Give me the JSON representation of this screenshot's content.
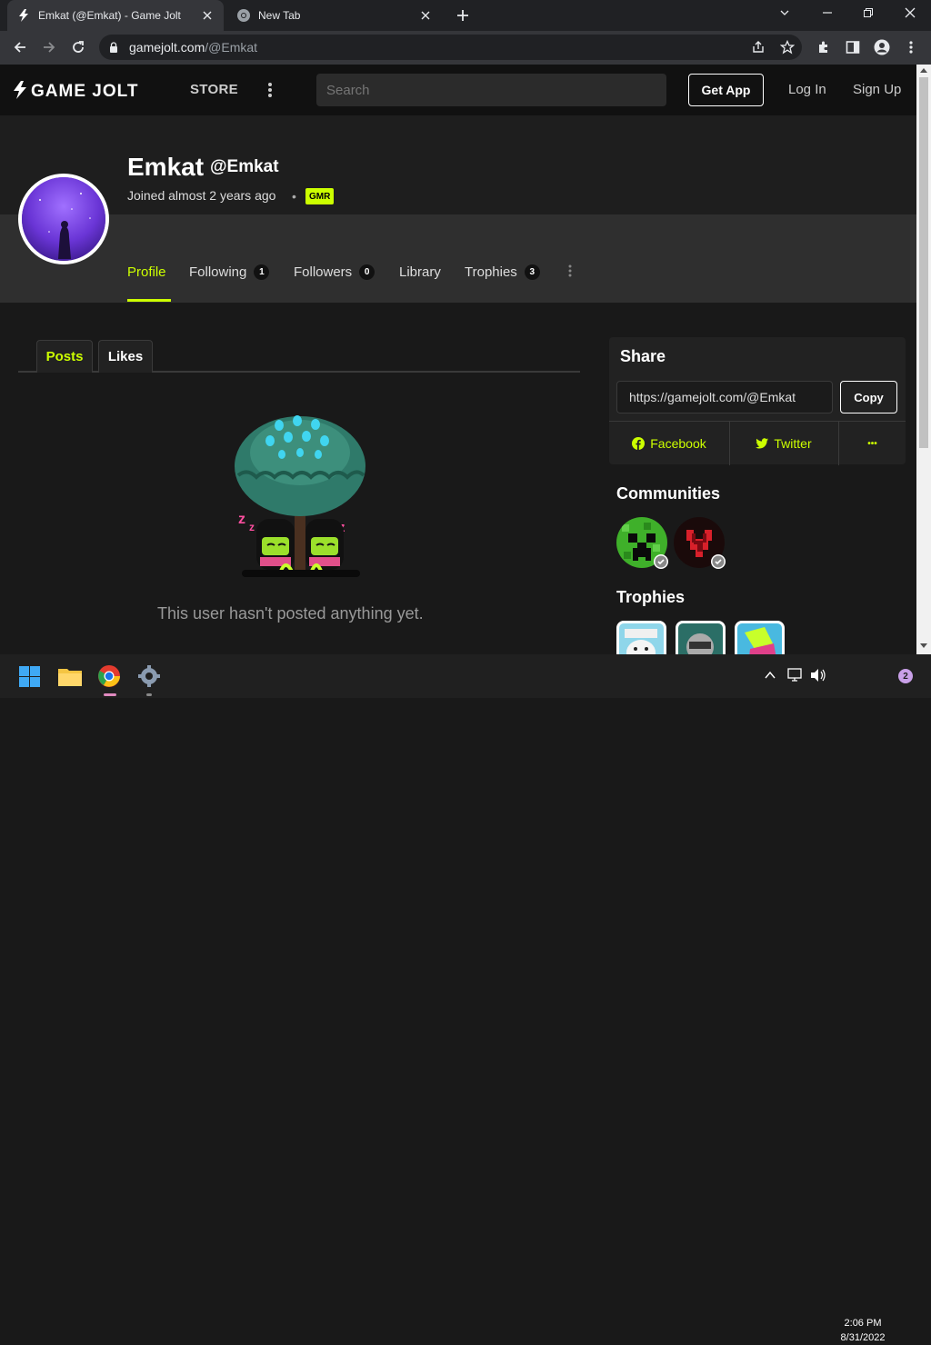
{
  "browser": {
    "tabs": [
      {
        "title": "Emkat (@Emkat) - Game Jolt",
        "active": true
      },
      {
        "title": "New Tab",
        "active": false
      }
    ],
    "url_host": "gamejolt.com",
    "url_path": "/@Emkat"
  },
  "header": {
    "logo": "GAME JOLT",
    "store": "STORE",
    "search_placeholder": "Search",
    "get_app": "Get App",
    "login": "Log In",
    "signup": "Sign Up"
  },
  "profile": {
    "name": "Emkat",
    "handle": "@Emkat",
    "joined": "Joined almost 2 years ago",
    "separator": "•",
    "badge": "GMR",
    "nav": [
      {
        "label": "Profile",
        "count": null,
        "active": true
      },
      {
        "label": "Following",
        "count": "1"
      },
      {
        "label": "Followers",
        "count": "0"
      },
      {
        "label": "Library",
        "count": null
      },
      {
        "label": "Trophies",
        "count": "3"
      }
    ]
  },
  "posts": {
    "tabs": [
      "Posts",
      "Likes"
    ],
    "empty_message": "This user hasn't posted anything yet."
  },
  "sidebar": {
    "share_title": "Share",
    "share_url": "https://gamejolt.com/@Emkat",
    "copy": "Copy",
    "facebook": "Facebook",
    "twitter": "Twitter",
    "more": "•••",
    "communities_title": "Communities",
    "trophies_title": "Trophies"
  },
  "taskbar": {
    "time": "2:06 PM",
    "date": "8/31/2022",
    "notifications": "2"
  },
  "colors": {
    "accent": "#ccff00",
    "background": "#191919",
    "header": "#111111"
  }
}
